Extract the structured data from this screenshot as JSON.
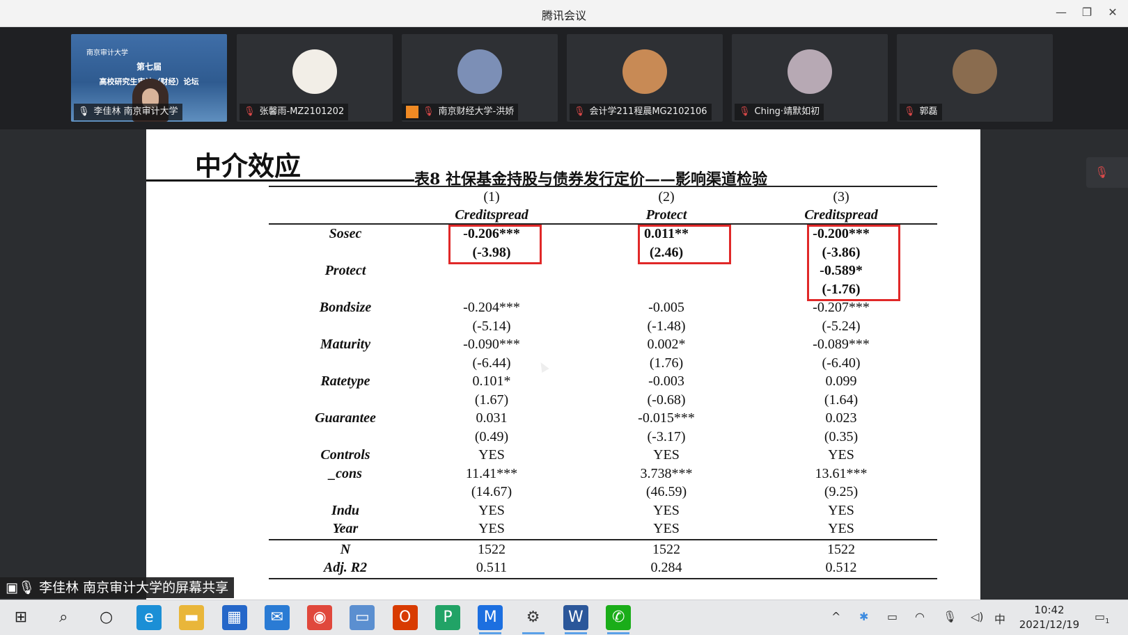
{
  "window": {
    "title": "腾讯会议",
    "minimize": "—",
    "restore": "❐",
    "close": "✕"
  },
  "participants": [
    {
      "name": "李佳林  南京审计大学",
      "muted": false,
      "type": "slide",
      "thumb_line1": "南京审计大学",
      "thumb_line2": "第七届",
      "thumb_line3": "高校研究生审计（财经）论坛"
    },
    {
      "name": "张馨雨-MZ2101202",
      "muted": true,
      "type": "avatar",
      "avatar_color": "#f2eee7"
    },
    {
      "name": "南京财经大学-洪娇",
      "muted": true,
      "type": "avatar",
      "avatar_color": "#7c8fb6"
    },
    {
      "name": "会计学211程晨MG2102106",
      "muted": true,
      "type": "avatar",
      "avatar_color": "#c88a55"
    },
    {
      "name": "Ching·靖默如初",
      "muted": true,
      "type": "avatar",
      "avatar_color": "#b7a9b4"
    },
    {
      "name": "郭磊",
      "muted": true,
      "type": "avatar",
      "avatar_color": "#8a6c4f"
    }
  ],
  "slide": {
    "title": "中介效应",
    "caption": "表8 社保基金持股与债券发行定价——影响渠道检验",
    "columns": [
      {
        "num": "(1)",
        "name": "Creditspread"
      },
      {
        "num": "(2)",
        "name": "Protect"
      },
      {
        "num": "(3)",
        "name": "Creditspread"
      }
    ],
    "rows": [
      {
        "label": "Sosec",
        "bold": true,
        "values": [
          "-0.206***",
          "0.011**",
          "-0.200***"
        ],
        "t": [
          "(-3.98)",
          "(2.46)",
          "(-3.86)"
        ]
      },
      {
        "label": "Protect",
        "bold": true,
        "values": [
          "",
          "",
          "-0.589*"
        ],
        "t": [
          "",
          "",
          "(-1.76)"
        ]
      },
      {
        "label": "Bondsize",
        "values": [
          "-0.204***",
          "-0.005",
          "-0.207***"
        ],
        "t": [
          "(-5.14)",
          "(-1.48)",
          "(-5.24)"
        ]
      },
      {
        "label": "Maturity",
        "values": [
          "-0.090***",
          "0.002*",
          "-0.089***"
        ],
        "t": [
          "(-6.44)",
          "(1.76)",
          "(-6.40)"
        ]
      },
      {
        "label": "Ratetype",
        "values": [
          "0.101*",
          "-0.003",
          "0.099"
        ],
        "t": [
          "(1.67)",
          "(-0.68)",
          "(1.64)"
        ]
      },
      {
        "label": "Guarantee",
        "values": [
          "0.031",
          "-0.015***",
          "0.023"
        ],
        "t": [
          "(0.49)",
          "(-3.17)",
          "(0.35)"
        ]
      },
      {
        "label": "Controls",
        "values": [
          "YES",
          "YES",
          "YES"
        ]
      },
      {
        "label": "_cons",
        "values": [
          "11.41***",
          "3.738***",
          "13.61***"
        ],
        "t": [
          "(14.67)",
          "(46.59)",
          "(9.25)"
        ]
      },
      {
        "label": "Indu",
        "values": [
          "YES",
          "YES",
          "YES"
        ]
      },
      {
        "label": "Year",
        "values": [
          "YES",
          "YES",
          "YES"
        ]
      }
    ],
    "footer": [
      {
        "label": "N",
        "values": [
          "1522",
          "1522",
          "1522"
        ]
      },
      {
        "label": "Adj. R2",
        "values": [
          "0.511",
          "0.284",
          "0.512"
        ]
      }
    ]
  },
  "share_label": "李佳林  南京审计大学的屏幕共享",
  "taskbar": {
    "apps": [
      {
        "name": "start",
        "glyph": "⊞",
        "color": "#1e1e1e"
      },
      {
        "name": "search",
        "glyph": "⌕",
        "color": "#1e1e1e"
      },
      {
        "name": "task-view",
        "glyph": "○",
        "color": "#1e1e1e"
      },
      {
        "name": "edge",
        "glyph": "e",
        "color": "#1b8fd6"
      },
      {
        "name": "file-explorer",
        "glyph": "▬",
        "color": "#e9b63a"
      },
      {
        "name": "store",
        "glyph": "▦",
        "color": "#2567c9"
      },
      {
        "name": "mail",
        "glyph": "✉",
        "color": "#2a7bd4"
      },
      {
        "name": "chrome",
        "glyph": "◉",
        "color": "#e0483c"
      },
      {
        "name": "laptop",
        "glyph": "▭",
        "color": "#5b8fd0"
      },
      {
        "name": "office",
        "glyph": "O",
        "color": "#d83b01"
      },
      {
        "name": "pdf",
        "glyph": "P",
        "color": "#21a366"
      },
      {
        "name": "tencent-meeting",
        "glyph": "M",
        "color": "#1c6fe0"
      },
      {
        "name": "settings",
        "glyph": "⚙",
        "color": "#3a3a3a"
      },
      {
        "name": "word",
        "glyph": "W",
        "color": "#2b579a"
      },
      {
        "name": "wechat",
        "glyph": "✆",
        "color": "#1aad19"
      }
    ],
    "ime": "中",
    "time": "10:42",
    "date": "2021/12/19",
    "notification_count": "1"
  }
}
